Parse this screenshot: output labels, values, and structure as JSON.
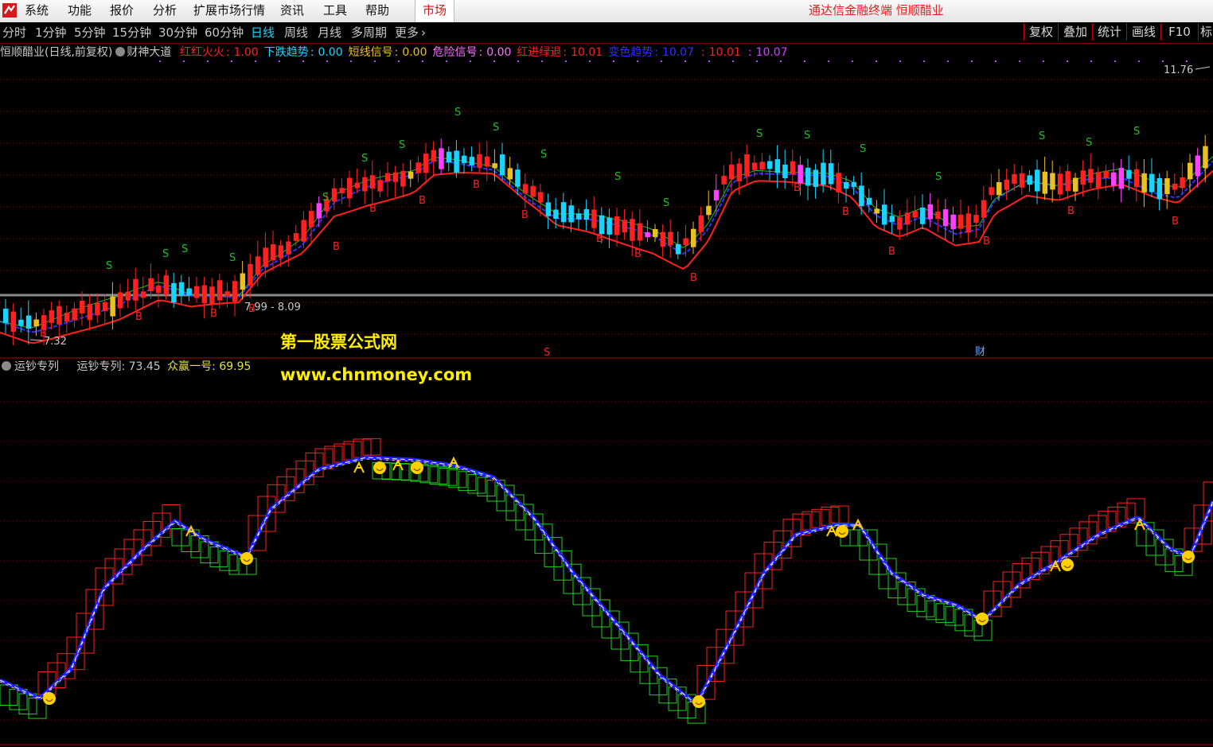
{
  "menu": {
    "items": [
      "系统",
      "功能",
      "报价",
      "分析",
      "扩展市场行情",
      "资讯",
      "工具",
      "帮助"
    ],
    "market_tab": "市场",
    "app_title": "通达信金融终端 恒顺醋业"
  },
  "periods": {
    "items": [
      "分时",
      "1分钟",
      "5分钟",
      "15分钟",
      "30分钟",
      "60分钟",
      "日线",
      "周线",
      "月线",
      "多周期",
      "更多"
    ],
    "active": "日线",
    "more_glyph": "›"
  },
  "toolbar": {
    "items": [
      "复权",
      "叠加",
      "统计",
      "画线",
      "F10",
      "标"
    ]
  },
  "main_panel": {
    "stock_label": "恒顺醋业(日线,前复权)",
    "indicator_name": "财神大道",
    "legend": [
      {
        "label": "红红火火",
        "value": "1.00",
        "color": "#ff2020"
      },
      {
        "label": "下跌趋势",
        "value": "0.00",
        "color": "#19d4ff"
      },
      {
        "label": "短线信号",
        "value": "0.00",
        "color": "#e8c020"
      },
      {
        "label": "危险信号",
        "value": "0.00",
        "color": "#ff70ff"
      },
      {
        "label": "红进绿退",
        "value": "10.01",
        "color": "#ff2020"
      },
      {
        "label": "变色趋势",
        "value": "10.07",
        "color": "#3030ff"
      },
      {
        "label": "",
        "value": "10.01",
        "color": "#ff2020"
      },
      {
        "label": "",
        "value": "10.07",
        "color": "#d040ff"
      }
    ],
    "price_high": "11.76",
    "price_low": "7.32",
    "range_label": "7.99 - 8.09",
    "marker_s": "S",
    "marker_b": "B",
    "bottom_s_marker": "S",
    "bottom_cai_marker": "财",
    "colors": {
      "up": "#ff2020",
      "down": "#19d4ff",
      "yellow": "#e8c020",
      "magenta": "#ff40ff",
      "ma_red": "#ff2020",
      "ma_blue": "#3030ff",
      "ma_green": "#20c020"
    }
  },
  "sub_panel": {
    "name": "运钞专列",
    "legend": [
      {
        "label": "运钞专列",
        "value": "73.45",
        "color": "#c8c8c8"
      },
      {
        "label": "众赢一号",
        "value": "69.95",
        "color": "#e8e040"
      }
    ],
    "colors": {
      "rise": "#ff2020",
      "fall": "#20d020",
      "blue": "#2020ff",
      "smile": "#ffd000"
    }
  },
  "watermark": {
    "cn": "第一股票公式网",
    "url": "www.chnmoney.com"
  }
}
